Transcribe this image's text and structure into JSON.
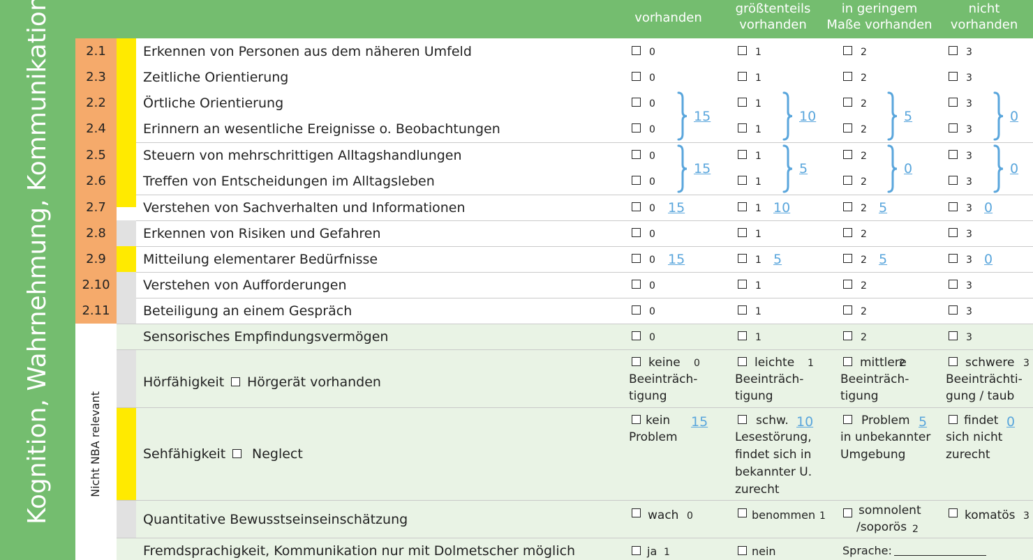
{
  "side_title": "Kognition, Wahrnehmung, Kommunikation",
  "side_subtitle": "Nicht NBA relevant",
  "columns": [
    {
      "line1": "vorhanden",
      "line2": ""
    },
    {
      "line1": "größtenteils",
      "line2": "vorhanden"
    },
    {
      "line1": "in geringem",
      "line2": "Maße vorhanden"
    },
    {
      "line1": "nicht",
      "line2": "vorhanden"
    }
  ],
  "rows": [
    {
      "id": "2.1",
      "label": "Erkennen von Personen aus dem näheren Umfeld",
      "opts": [
        "0",
        "1",
        "2",
        "3"
      ]
    },
    {
      "id": "2.3",
      "label": "Zeitliche Orientierung",
      "opts": [
        "0",
        "1",
        "2",
        "3"
      ]
    },
    {
      "id": "2.2",
      "label": "Örtliche Orientierung",
      "opts": [
        "0",
        "1",
        "2",
        "3"
      ]
    },
    {
      "id": "2.4",
      "label": "Erinnern an wesentliche Ereignisse o. Beobachtungen",
      "opts": [
        "0",
        "1",
        "2",
        "3"
      ]
    },
    {
      "id": "2.5",
      "label": "Steuern von mehrschrittigen Alltagshandlungen",
      "opts": [
        "0",
        "1",
        "2",
        "3"
      ]
    },
    {
      "id": "2.6",
      "label": "Treffen von Entscheidungen im Alltagsleben",
      "opts": [
        "0",
        "1",
        "2",
        "3"
      ]
    },
    {
      "id": "2.7",
      "label": "Verstehen von Sachverhalten und Informationen",
      "opts": [
        "0",
        "1",
        "2",
        "3"
      ]
    },
    {
      "id": "2.8",
      "label": "Erkennen von Risiken und Gefahren",
      "opts": [
        "0",
        "1",
        "2",
        "3"
      ]
    },
    {
      "id": "2.9",
      "label": "Mitteilung elementarer Bedürfnisse",
      "opts": [
        "0",
        "1",
        "2",
        "3"
      ]
    },
    {
      "id": "2.10",
      "label": "Verstehen von Aufforderungen",
      "opts": [
        "0",
        "1",
        "2",
        "3"
      ]
    },
    {
      "id": "2.11",
      "label": "Beteiligung an einem Gespräch",
      "opts": [
        "0",
        "1",
        "2",
        "3"
      ]
    },
    {
      "id": "",
      "label": "Sensorisches Empfindungsvermögen",
      "opts": [
        "0",
        "1",
        "2",
        "3"
      ]
    }
  ],
  "scores": {
    "group_a": [
      "15",
      "10",
      "5",
      "0"
    ],
    "group_b": [
      "15",
      "5",
      "0",
      "0"
    ],
    "row_27": [
      "15",
      "10",
      "5",
      "0"
    ],
    "row_29": [
      "15",
      "5",
      "5",
      "0"
    ]
  },
  "hoer": {
    "label": "Hörfähigkeit",
    "extra": "Hörgerät vorhanden",
    "opts": [
      {
        "w1": "keine",
        "n": "0",
        "w2": "Beeinträch-",
        "w3": "tigung"
      },
      {
        "w1": "leichte",
        "n": "1",
        "w2": "Beeinträch-",
        "w3": "tigung"
      },
      {
        "w1": "mittlere",
        "n": "2",
        "w2": "Beeinträch-",
        "w3": "tigung"
      },
      {
        "w1": "schwere",
        "n": "3",
        "w2": "Beeinträchti-",
        "w3": "gung / taub"
      }
    ]
  },
  "seh": {
    "label": "Sehfähigkeit",
    "extra": "Neglect",
    "opts": [
      {
        "w1": "kein",
        "s": "15",
        "lines": [
          "Problem"
        ]
      },
      {
        "w1": "schw.",
        "s": "10",
        "lines": [
          "Lesestörung,",
          "findet sich in",
          "bekannter U.",
          "zurecht"
        ]
      },
      {
        "w1": "Problem",
        "s": "5",
        "lines": [
          "in unbekannter",
          "Umgebung"
        ]
      },
      {
        "w1": "findet",
        "s": "0",
        "lines": [
          "sich nicht",
          "zurecht"
        ]
      }
    ]
  },
  "bewusst": {
    "label": "Quantitative Bewusstseinseinschätzung",
    "o1": "wach",
    "n1": "0",
    "o2": "benommen",
    "n2": "1",
    "o3a": "somnolent",
    "o3b": "/soporös",
    "n3": "2",
    "o4": "komatös",
    "n4": "3"
  },
  "fremd": {
    "label": "Fremdsprachigkeit, Kommunikation nur mit Dolmetscher möglich",
    "o1": "ja",
    "n1": "1",
    "o2": "nein",
    "sprache": "Sprache:"
  }
}
